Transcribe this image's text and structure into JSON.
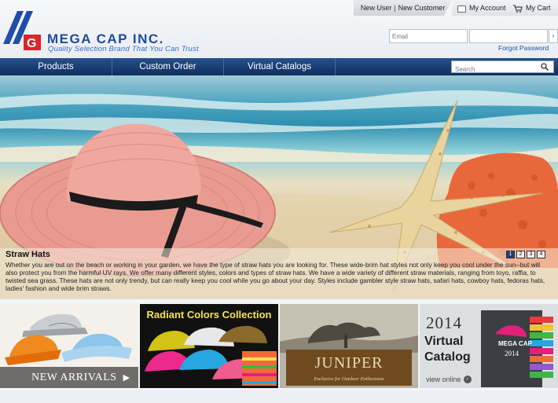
{
  "header": {
    "brand": "MEGA CAP INC.",
    "tagline": "Quality Selection Brand That You Can Trust",
    "user_links": {
      "new_user": "New User",
      "new_customer": "New Customer"
    },
    "my_account": "My Account",
    "my_cart": "My Cart",
    "email_placeholder": "Email",
    "password_placeholder": "",
    "go": "›",
    "forgot_password": "Forgot Password"
  },
  "nav": {
    "items": [
      {
        "label": "Products"
      },
      {
        "label": "Custom Order"
      },
      {
        "label": "Virtual Catalogs"
      },
      {
        "label": ""
      }
    ],
    "search_placeholder": "Search"
  },
  "hero": {
    "title": "Straw Hats",
    "text": "Whether you are out on the beach or working in your garden, we have the type of straw hats you are looking for. These wide-brim hat styles not only keep you cool under the sun--but will also protect you from the harmful UV rays. We offer many different styles, colors and types of straw hats. We have a wide variety of different straw materials, ranging from toyo, raffia, to twisted sea grass. These hats are not only trendy, but can really keep you cool while you go about your day. Styles include gambler style straw hats, safari hats, cowboy hats, fedoras hats, ladies' fashion and wide brim straws.",
    "pages": [
      "1",
      "2",
      "3",
      "4"
    ],
    "active_page": 1
  },
  "tiles": {
    "new_arrivals": "NEW ARRIVALS",
    "radiant": "Radiant Colors Collection",
    "juniper": "JUNIPER",
    "juniper_sub": "Exclusive for Outdoor Enthusiasts",
    "catalog_year": "2014",
    "catalog_line1": "Virtual",
    "catalog_line2": "Catalog",
    "catalog_view": "view online",
    "catalog_cover_brand": "MEGA CAP",
    "catalog_cover_year": "2014"
  },
  "colors": {
    "brand_blue": "#1d4aa0",
    "logo_red": "#d8262c",
    "nav_blue": "#1b3f75",
    "hat_pink": "#e89a92"
  }
}
